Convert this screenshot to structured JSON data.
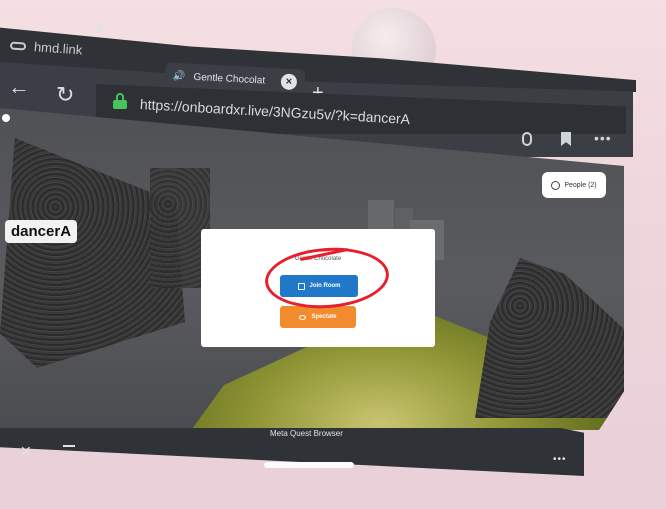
{
  "system": {
    "hmd_link": "hmd.link"
  },
  "tab": {
    "title": "Gentle Chocolat",
    "close": "×",
    "new_tab": "+"
  },
  "toolbar": {
    "back": "←",
    "reload": "↻",
    "url": "https://onboardxr.live/3NGzu5v/?k=dancerA",
    "more": "•••"
  },
  "scene": {
    "avatar_label": "dancerA",
    "people_button": "People (2)"
  },
  "modal": {
    "heading": "Room Name",
    "name": "Gentle Chocolate",
    "join_button": "Join Room",
    "spectate_button": "Spectate"
  },
  "bottom_bar": {
    "title": "Meta Quest Browser",
    "close": "✕",
    "more": "•••"
  },
  "colors": {
    "join": "#1f78c8",
    "spectate": "#f28a2e",
    "annotation": "#e5202c",
    "lock": "#47c25c"
  }
}
